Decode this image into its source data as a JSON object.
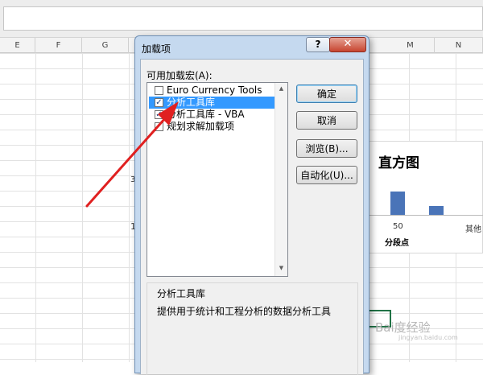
{
  "sheet": {
    "columns": [
      "E",
      "F",
      "G",
      "H",
      "M",
      "N"
    ],
    "left_fragments": [
      "3",
      "1"
    ],
    "chart": {
      "title": "直方图",
      "tick_labels": [
        "50",
        "其他"
      ],
      "xlabel": "分段点"
    },
    "watermark": "Bai度经验",
    "watermark_sub": "jingyan.baidu.com"
  },
  "dialog": {
    "title": "加载项",
    "help_label": "?",
    "close_label": "✕",
    "list_label": "可用加载宏(A):",
    "addins": [
      {
        "label": "Euro Currency Tools",
        "checked": false,
        "selected": false
      },
      {
        "label": "分析工具库",
        "checked": true,
        "selected": true
      },
      {
        "label": "分析工具库 - VBA",
        "checked": true,
        "selected": false
      },
      {
        "label": "规划求解加载项",
        "checked": false,
        "selected": false
      }
    ],
    "buttons": {
      "ok": "确定",
      "cancel": "取消",
      "browse": "浏览(B)...",
      "automation": "自动化(U)..."
    },
    "description": {
      "title": "分析工具库",
      "text": "提供用于统计和工程分析的数据分析工具"
    }
  },
  "annotation": {
    "arrow_color": "#e02020"
  }
}
